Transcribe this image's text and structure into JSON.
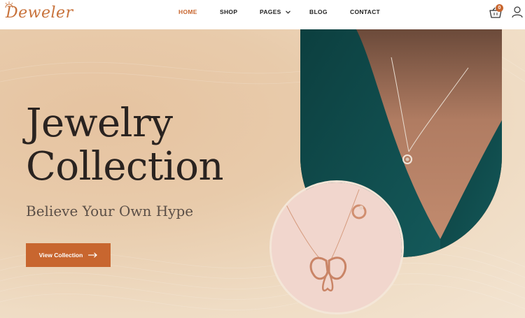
{
  "brand": {
    "logo_text": "Deweler"
  },
  "nav": {
    "items": [
      {
        "label": "HOME",
        "active": true
      },
      {
        "label": "SHOP",
        "active": false
      },
      {
        "label": "PAGES",
        "active": false,
        "has_dropdown": true
      },
      {
        "label": "BLOG",
        "active": false
      },
      {
        "label": "CONTACT",
        "active": false
      }
    ]
  },
  "header_actions": {
    "cart_count": "0",
    "cart_icon": "basket-icon",
    "user_icon": "user-icon"
  },
  "hero": {
    "title_line1": "Jewelry",
    "title_line2": "Collection",
    "subtitle": "Believe Your Own Hype",
    "cta_label": "View Collection",
    "cta_icon": "arrow-right-icon"
  },
  "colors": {
    "accent": "#c8662f",
    "text_dark": "#2a2320",
    "teal": "#0f4a4a",
    "bg_peach": "#e8cbab"
  }
}
